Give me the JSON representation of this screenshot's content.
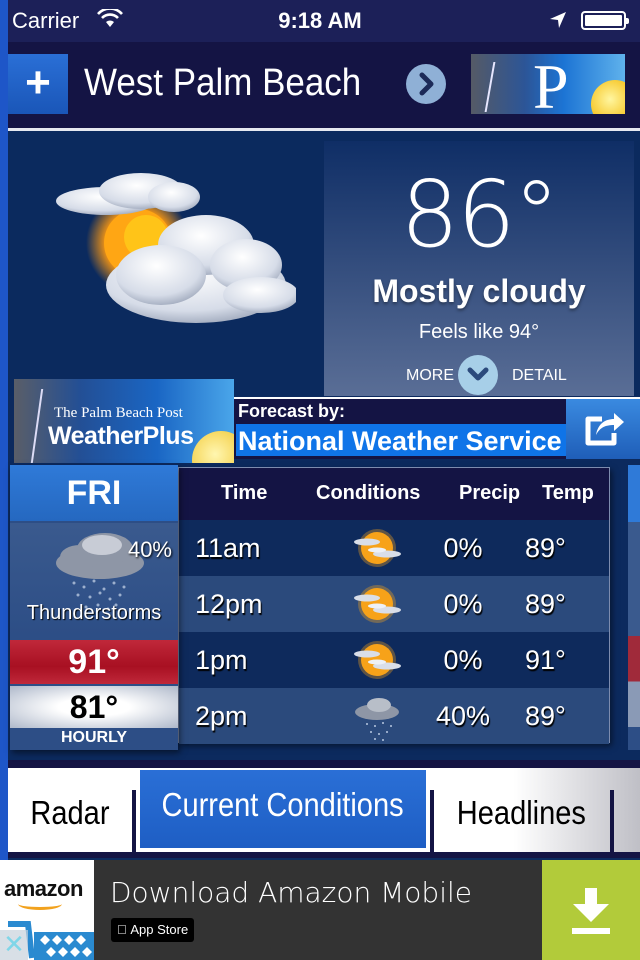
{
  "status_bar": {
    "carrier": "Carrier",
    "time": "9:18 AM",
    "battery_level": 1.0
  },
  "header": {
    "add_label": "+",
    "city": "West Palm Beach",
    "next_label": "›",
    "logo_letter": "P"
  },
  "current": {
    "icon": "mostly-cloudy-icon",
    "temperature": "86°",
    "condition": "Mostly cloudy",
    "feels_like": "Feels like 94°",
    "more_label": "MORE",
    "detail_label": "DETAIL"
  },
  "forecast_by": {
    "logo_line1": "The Palm Beach Post",
    "logo_line2": "WeatherPlus",
    "label": "Forecast by:",
    "source": "National Weather Service"
  },
  "day_card": {
    "day": "FRI",
    "precip": "40%",
    "icon": "thunderstorms-icon",
    "condition": "Thunderstorms",
    "high": "91°",
    "low": "81°",
    "hourly_label": "HOURLY"
  },
  "hourly": {
    "headers": [
      "Time",
      "Conditions",
      "Precip",
      "Temp"
    ],
    "rows": [
      {
        "time": "11am",
        "icon": "partly-sunny-icon",
        "precip": "0%",
        "temp": "89°"
      },
      {
        "time": "12pm",
        "icon": "partly-sunny-icon",
        "precip": "0%",
        "temp": "89°"
      },
      {
        "time": "1pm",
        "icon": "partly-sunny-icon",
        "precip": "0%",
        "temp": "91°"
      },
      {
        "time": "2pm",
        "icon": "rain-cloud-icon",
        "precip": "40%",
        "temp": "89°"
      }
    ]
  },
  "tabs": [
    {
      "label": "Radar",
      "active": false
    },
    {
      "label": "Current Conditions",
      "active": true
    },
    {
      "label": "Headlines",
      "active": false
    }
  ],
  "ad": {
    "brand": "amazon",
    "title": "Download Amazon Mobile",
    "store_badge": " App Store",
    "close_label": "✕",
    "colors": {
      "download_bg": "#b2cb3a",
      "bar_bg": "#333333"
    }
  },
  "colors": {
    "accent_blue": "#2a6fd6",
    "header_bg": "#141444",
    "high_temp_red": "#c0283a",
    "source_blue": "#0f74e8"
  }
}
